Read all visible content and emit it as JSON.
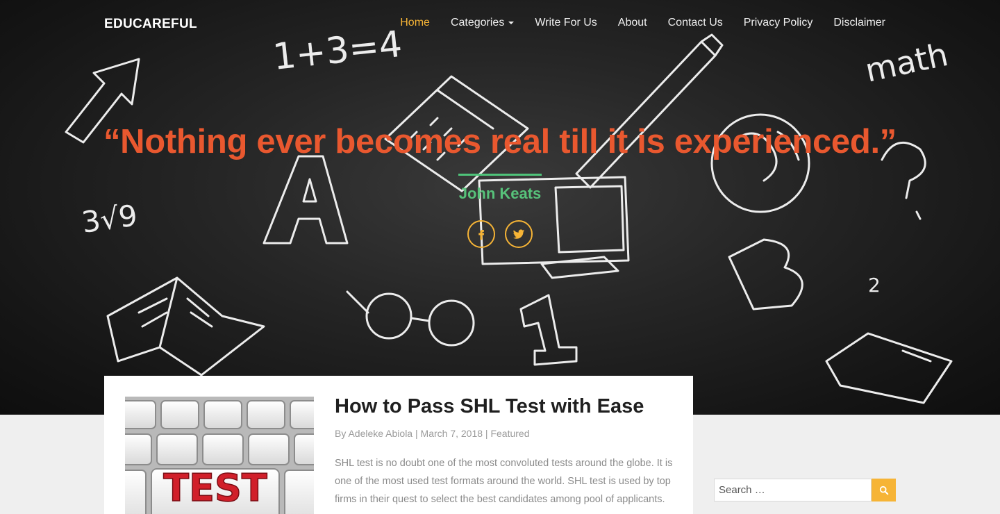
{
  "site": {
    "brand": "EDUCAREFUL"
  },
  "nav": {
    "items": [
      {
        "label": "Home"
      },
      {
        "label": "Categories"
      },
      {
        "label": "Write For Us"
      },
      {
        "label": "About"
      },
      {
        "label": "Contact Us"
      },
      {
        "label": "Privacy Policy"
      },
      {
        "label": "Disclaimer"
      }
    ]
  },
  "hero": {
    "quote": "“Nothing ever becomes real till it is experienced.”",
    "author": "John Keats",
    "doodle_text": {
      "equation": "1+3=4",
      "math": "math",
      "root": "3√9",
      "two": "2"
    },
    "social": [
      {
        "icon": "facebook-icon"
      },
      {
        "icon": "twitter-icon"
      }
    ]
  },
  "post": {
    "title": "How to Pass SHL Test with Ease",
    "meta": {
      "by": "By",
      "author": "Adeleke Abiola",
      "sep": "|",
      "date": "March 7, 2018",
      "category": "Featured"
    },
    "excerpt": "SHL test is no doubt one of the most convoluted tests around the globe. It is one of the most used test formats around the world. SHL test is used by top firms in their quest to select the best candidates among pool of applicants.",
    "thumbnail_text": "TEST"
  },
  "sidebar": {
    "search": {
      "placeholder": "Search …",
      "icon": "search-icon"
    }
  },
  "colors": {
    "accent": "#f6b436",
    "quote": "#e9582f",
    "author": "#57c27a"
  }
}
